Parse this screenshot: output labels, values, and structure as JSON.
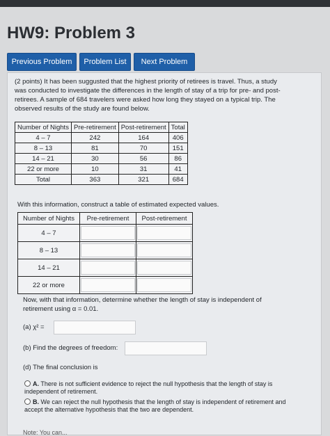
{
  "title": "HW9: Problem 3",
  "nav": {
    "prev": "Previous Problem",
    "list": "Problem List",
    "next": "Next Problem"
  },
  "intro": "(2 points) It has been suggusted that the highest priority of retirees is travel. Thus, a study was conducted to investigate the differences in the length of stay of a trip for pre- and post-retirees. A sample of 684 travelers were asked how long they stayed on a typical trip. The observed results of the study are found below.",
  "observed": {
    "headers": [
      "Number of Nights",
      "Pre-retirement",
      "Post-retirement",
      "Total"
    ],
    "rows": [
      [
        "4 – 7",
        "242",
        "164",
        "406"
      ],
      [
        "8 – 13",
        "81",
        "70",
        "151"
      ],
      [
        "14 – 21",
        "30",
        "56",
        "86"
      ],
      [
        "22 or more",
        "10",
        "31",
        "41"
      ],
      [
        "Total",
        "363",
        "321",
        "684"
      ]
    ]
  },
  "expected_instruction": "With this information, construct a table of estimated expected values.",
  "expected": {
    "headers": [
      "Number of Nights",
      "Pre-retirement",
      "Post-retirement"
    ],
    "rows": [
      "4 – 7",
      "8 – 13",
      "14 – 21",
      "22 or more"
    ]
  },
  "question_intro": "Now, with that information, determine whether the length of stay is independent of retirement using α = 0.01.",
  "q_a": "(a) χ² =",
  "q_b": "(b) Find the degrees of freedom:",
  "q_d": "(d) The final conclusion is",
  "choice_a_letter": "A.",
  "choice_a": "There is not sufficient evidence to reject the null hypothesis that the length of stay is independent of retirement.",
  "choice_b_letter": "B.",
  "choice_b": "We can reject the null hypothesis that the length of stay is independent of retirement and accept the alternative hypothesis that the two are dependent.",
  "footer": "Note: You can..."
}
